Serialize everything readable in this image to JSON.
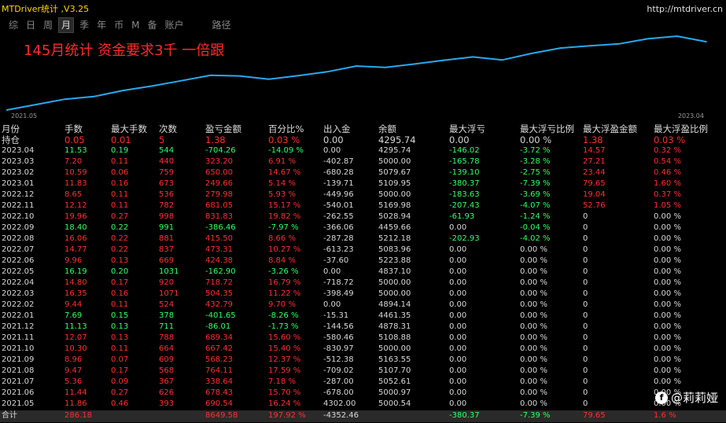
{
  "app_title": "MTDriver统计 ,V3.25",
  "site": "http://mtdriver.cn",
  "tabs": [
    "综",
    "日",
    "周",
    "月",
    "季",
    "年",
    "币",
    "M",
    "备",
    "账户",
    "路径"
  ],
  "active_tab": "月",
  "chart_data": {
    "type": "line",
    "title": "145月统计 资金要求3千 一倍跟",
    "x_start_label": "2021.05",
    "x_end_label": "2023.04",
    "x": [
      "2021.05",
      "2021.06",
      "2021.07",
      "2021.08",
      "2021.09",
      "2021.10",
      "2021.11",
      "2021.12",
      "2022.01",
      "2022.02",
      "2022.03",
      "2022.04",
      "2022.05",
      "2022.06",
      "2022.07",
      "2022.08",
      "2022.09",
      "2022.10",
      "2022.11",
      "2022.12",
      "2023.01",
      "2023.02",
      "2023.03",
      "2023.04"
    ],
    "values": [
      690.54,
      1368.97,
      1707.61,
      2471.72,
      3039.95,
      3707.37,
      4396.71,
      4310.7,
      3909.05,
      4341.84,
      4846.19,
      5564.91,
      5402.01,
      5826.39,
      6299.7,
      6715.2,
      6328.74,
      7160.57,
      7841.62,
      8121.6,
      8371.26,
      9021.26,
      9344.46,
      8640.2
    ],
    "color": "#29a9f0"
  },
  "headers": [
    "月份",
    "手数",
    "最大手数",
    "次数",
    "盈亏金额",
    "百分比%",
    "出入金",
    "余额",
    "最大浮亏",
    "最大浮亏比例",
    "最大浮盈金额",
    "最大浮盈比例"
  ],
  "hold_row": [
    "持仓",
    "0.05",
    "0.01",
    "5",
    "1.38",
    "0.03 %",
    "0.00",
    "4295.74",
    "0.00",
    "0.00 %",
    "1.38",
    "0.03 %"
  ],
  "rows": [
    [
      "2023.04",
      "11.53",
      "0.19",
      "544",
      "-704.26",
      "-14.09 %",
      "0.00",
      "4295.74",
      "-146.02",
      "-3.72 %",
      "14.57",
      "0.32 %"
    ],
    [
      "2023.03",
      "7.20",
      "0.11",
      "440",
      "323.20",
      "6.91 %",
      "-402.87",
      "5000.00",
      "-165.78",
      "-3.28 %",
      "27.21",
      "0.54 %"
    ],
    [
      "2023.02",
      "10.59",
      "0.06",
      "759",
      "650.00",
      "14.67 %",
      "-680.28",
      "5079.67",
      "-139.10",
      "-2.75 %",
      "23.44",
      "0.46 %"
    ],
    [
      "2023.01",
      "11.83",
      "0.16",
      "673",
      "249.66",
      "5.14 %",
      "-139.71",
      "5109.95",
      "-380.37",
      "-7.39 %",
      "79.65",
      "1.60 %"
    ],
    [
      "2022.12",
      "8.65",
      "0.11",
      "536",
      "279.98",
      "5.93 %",
      "-449.96",
      "5000.00",
      "-183.63",
      "-3.69 %",
      "19.04",
      "0.37 %"
    ],
    [
      "2022.11",
      "12.12",
      "0.11",
      "782",
      "681.05",
      "15.17 %",
      "-540.01",
      "5169.98",
      "-207.43",
      "-4.07 %",
      "52.76",
      "1.05 %"
    ],
    [
      "2022.10",
      "19.96",
      "0.27",
      "998",
      "831.83",
      "19.82 %",
      "-262.55",
      "5028.94",
      "-61.93",
      "-1.24 %",
      "0",
      "0.00 %"
    ],
    [
      "2022.09",
      "18.40",
      "0.22",
      "991",
      "-386.46",
      "-7.97 %",
      "-366.06",
      "4459.66",
      "0.00",
      "-0.04 %",
      "0",
      "0.00 %"
    ],
    [
      "2022.08",
      "16.06",
      "0.22",
      "881",
      "415.50",
      "8.66 %",
      "-287.28",
      "5212.18",
      "-202.93",
      "-4.02 %",
      "0",
      "0.00 %"
    ],
    [
      "2022.07",
      "14.77",
      "0.22",
      "837",
      "473.31",
      "10.27 %",
      "-613.23",
      "5083.96",
      "0.00",
      "0.00 %",
      "0",
      "0.00 %"
    ],
    [
      "2022.06",
      "9.96",
      "0.13",
      "669",
      "424.38",
      "8.84 %",
      "-37.60",
      "5223.88",
      "0.00",
      "0.00 %",
      "0",
      "0.00 %"
    ],
    [
      "2022.05",
      "16.19",
      "0.20",
      "1031",
      "-162.90",
      "-3.26 %",
      "0.00",
      "4837.10",
      "0.00",
      "0.00 %",
      "0",
      "0.00 %"
    ],
    [
      "2022.04",
      "14.80",
      "0.17",
      "920",
      "718.72",
      "16.79 %",
      "-718.72",
      "5000.00",
      "0.00",
      "0.00 %",
      "0",
      "0.00 %"
    ],
    [
      "2022.03",
      "16.35",
      "0.16",
      "1071",
      "504.35",
      "11.22 %",
      "-398.49",
      "5000.00",
      "0.00",
      "0.00 %",
      "0",
      "0.00 %"
    ],
    [
      "2022.02",
      "9.44",
      "0.11",
      "524",
      "432.79",
      "9.70 %",
      "0.00",
      "4894.14",
      "0.00",
      "0.00 %",
      "0",
      "0.00 %"
    ],
    [
      "2022.01",
      "7.69",
      "0.15",
      "378",
      "-401.65",
      "-8.26 %",
      "-15.31",
      "4461.35",
      "0.00",
      "0.00 %",
      "0",
      "0.00 %"
    ],
    [
      "2021.12",
      "11.13",
      "0.13",
      "711",
      "-86.01",
      "-1.73 %",
      "-144.56",
      "4878.31",
      "0.00",
      "0.00 %",
      "0",
      "0.00 %"
    ],
    [
      "2021.11",
      "12.07",
      "0.13",
      "788",
      "689.34",
      "15.60 %",
      "-580.46",
      "5108.88",
      "0.00",
      "0.00 %",
      "0",
      "0.00 %"
    ],
    [
      "2021.10",
      "10.30",
      "0.11",
      "664",
      "667.42",
      "15.40 %",
      "-830.97",
      "5000.00",
      "0.00",
      "0.00 %",
      "0",
      "0.00 %"
    ],
    [
      "2021.09",
      "8.96",
      "0.07",
      "609",
      "568.23",
      "12.37 %",
      "-512.38",
      "5163.55",
      "0.00",
      "0.00 %",
      "0",
      "0.00 %"
    ],
    [
      "2021.08",
      "9.47",
      "0.17",
      "568",
      "764.11",
      "17.59 %",
      "-709.02",
      "5107.70",
      "0.00",
      "0.00 %",
      "0",
      "0.00 %"
    ],
    [
      "2021.07",
      "5.36",
      "0.09",
      "367",
      "338.64",
      "7.18 %",
      "-287.00",
      "5052.61",
      "0.00",
      "0.00 %",
      "0",
      "0.00 %"
    ],
    [
      "2021.06",
      "11.44",
      "0.27",
      "626",
      "678.43",
      "15.70 %",
      "-678.00",
      "5000.97",
      "0.00",
      "0.00 %",
      "0",
      "0.00 %"
    ],
    [
      "2021.05",
      "11.86",
      "0.46",
      "393",
      "690.54",
      "16.24 %",
      "4302.00",
      "5000.54",
      "0.00",
      "0.00 %",
      "0",
      "0.00 %"
    ]
  ],
  "total_row": [
    "合计",
    "286.18",
    "",
    "",
    "8649.58",
    "197.92 %",
    "-4352.46",
    "",
    "-380.37",
    "-7.39 %",
    "79.65",
    "1.6 %"
  ],
  "watermark": {
    "logo_glyph": "f",
    "text": "@莉莉娅"
  },
  "colors": {
    "positive": "#ff3030",
    "negative": "#33ff66",
    "neutral": "#d8d8d8",
    "title": "#ffd700"
  }
}
